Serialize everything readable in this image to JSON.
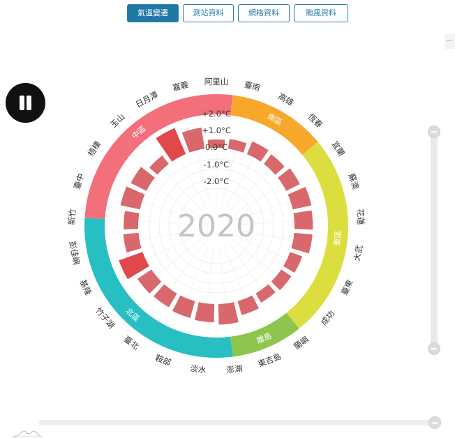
{
  "tabs": [
    {
      "label": "氣溫變遷",
      "active": true
    },
    {
      "label": "測站資料",
      "active": false
    },
    {
      "label": "網格資料",
      "active": false
    },
    {
      "label": "颱風資料",
      "active": false
    }
  ],
  "playback": {
    "state": "playing",
    "icon": "pause-icon"
  },
  "chart_data": {
    "type": "radial-bar",
    "year": "2020",
    "ticks": [
      "+2.0°C",
      "+1.0°C",
      "0.0°C",
      "-1.0°C",
      "-2.0°C"
    ],
    "range": [
      -2,
      2
    ],
    "stations": [
      {
        "name": "阿里山",
        "value": 0.0
      },
      {
        "name": "臺南",
        "value": 0.1
      },
      {
        "name": "高雄",
        "value": 0.35
      },
      {
        "name": "恆春",
        "value": 0.25
      },
      {
        "name": "宜蘭",
        "value": 0.45
      },
      {
        "name": "蘇澳",
        "value": 0.7
      },
      {
        "name": "花蓮",
        "value": 0.65
      },
      {
        "name": "大武",
        "value": 0.65
      },
      {
        "name": "臺東",
        "value": 0.3
      },
      {
        "name": "成功",
        "value": 0.25
      },
      {
        "name": "蘭嶼",
        "value": 0.15
      },
      {
        "name": "東吉島",
        "value": 0.4
      },
      {
        "name": "澎湖",
        "value": 0.8
      },
      {
        "name": "淡水",
        "value": 0.65
      },
      {
        "name": "鞍部",
        "value": 0.6
      },
      {
        "name": "臺北",
        "value": 0.5
      },
      {
        "name": "竹子湖",
        "value": 0.55
      },
      {
        "name": "基隆",
        "value": 1.1
      },
      {
        "name": "彭佳嶼",
        "value": 0.45
      },
      {
        "name": "新竹",
        "value": 0.4
      },
      {
        "name": "臺中",
        "value": 0.75
      },
      {
        "name": "梧棲",
        "value": 0.6
      },
      {
        "name": "玉山",
        "value": 0.15
      },
      {
        "name": "日月潭",
        "value": 1.3
      },
      {
        "name": "嘉義",
        "value": 0.85
      }
    ],
    "regions": [
      {
        "name": "南區",
        "color": "#f7a72a",
        "from": 1,
        "to": 4
      },
      {
        "name": "東區",
        "color": "#dcde40",
        "from": 4,
        "to": 10.3
      },
      {
        "name": "離島",
        "color": "#8dc64e",
        "from": 10.3,
        "to": 12.5
      },
      {
        "name": "北區",
        "color": "#28bfc3",
        "from": 12.5,
        "to": 19.5
      },
      {
        "name": "中區",
        "color": "#f3707a",
        "from": 19.5,
        "to": 26
      }
    ],
    "colors": {
      "bar": "#d9686c",
      "bar_strong": "#e0484c",
      "ring_guide": "#eeeeee"
    }
  }
}
